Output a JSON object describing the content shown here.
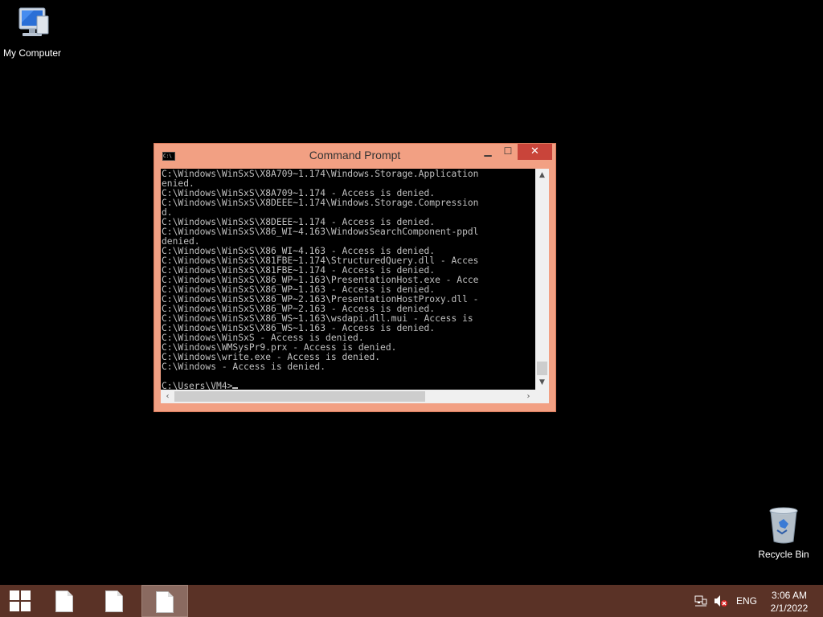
{
  "desktop": {
    "icons": [
      {
        "label": "My Computer",
        "icon": "computer-icon"
      },
      {
        "label": "Recycle Bin",
        "icon": "recycle-bin-icon"
      }
    ]
  },
  "window": {
    "title": "Command Prompt",
    "app_icon_text": "C:\\",
    "controls": {
      "minimize": "▁",
      "maximize": "☐",
      "close": "✕"
    },
    "console_lines": [
      "C:\\Windows\\WinSxS\\X8A709~1.174\\Windows.Storage.Application",
      "enied.",
      "C:\\Windows\\WinSxS\\X8A709~1.174 - Access is denied.",
      "C:\\Windows\\WinSxS\\X8DEEE~1.174\\Windows.Storage.Compression",
      "d.",
      "C:\\Windows\\WinSxS\\X8DEEE~1.174 - Access is denied.",
      "C:\\Windows\\WinSxS\\X86_WI~4.163\\WindowsSearchComponent-ppdl",
      "denied.",
      "C:\\Windows\\WinSxS\\X86_WI~4.163 - Access is denied.",
      "C:\\Windows\\WinSxS\\X81FBE~1.174\\StructuredQuery.dll - Acces",
      "C:\\Windows\\WinSxS\\X81FBE~1.174 - Access is denied.",
      "C:\\Windows\\WinSxS\\X86_WP~1.163\\PresentationHost.exe - Acce",
      "C:\\Windows\\WinSxS\\X86_WP~1.163 - Access is denied.",
      "C:\\Windows\\WinSxS\\X86_WP~2.163\\PresentationHostProxy.dll -",
      "C:\\Windows\\WinSxS\\X86_WP~2.163 - Access is denied.",
      "C:\\Windows\\WinSxS\\X86_WS~1.163\\wsdapi.dll.mui - Access is",
      "C:\\Windows\\WinSxS\\X86_WS~1.163 - Access is denied.",
      "C:\\Windows\\WinSxS - Access is denied.",
      "C:\\Windows\\WMSysPr9.prx - Access is denied.",
      "C:\\Windows\\write.exe - Access is denied.",
      "C:\\Windows - Access is denied.",
      "",
      "C:\\Users\\VM4>"
    ]
  },
  "taskbar": {
    "tray": {
      "language": "ENG",
      "time": "3:06 AM",
      "date": "2/1/2022"
    }
  }
}
